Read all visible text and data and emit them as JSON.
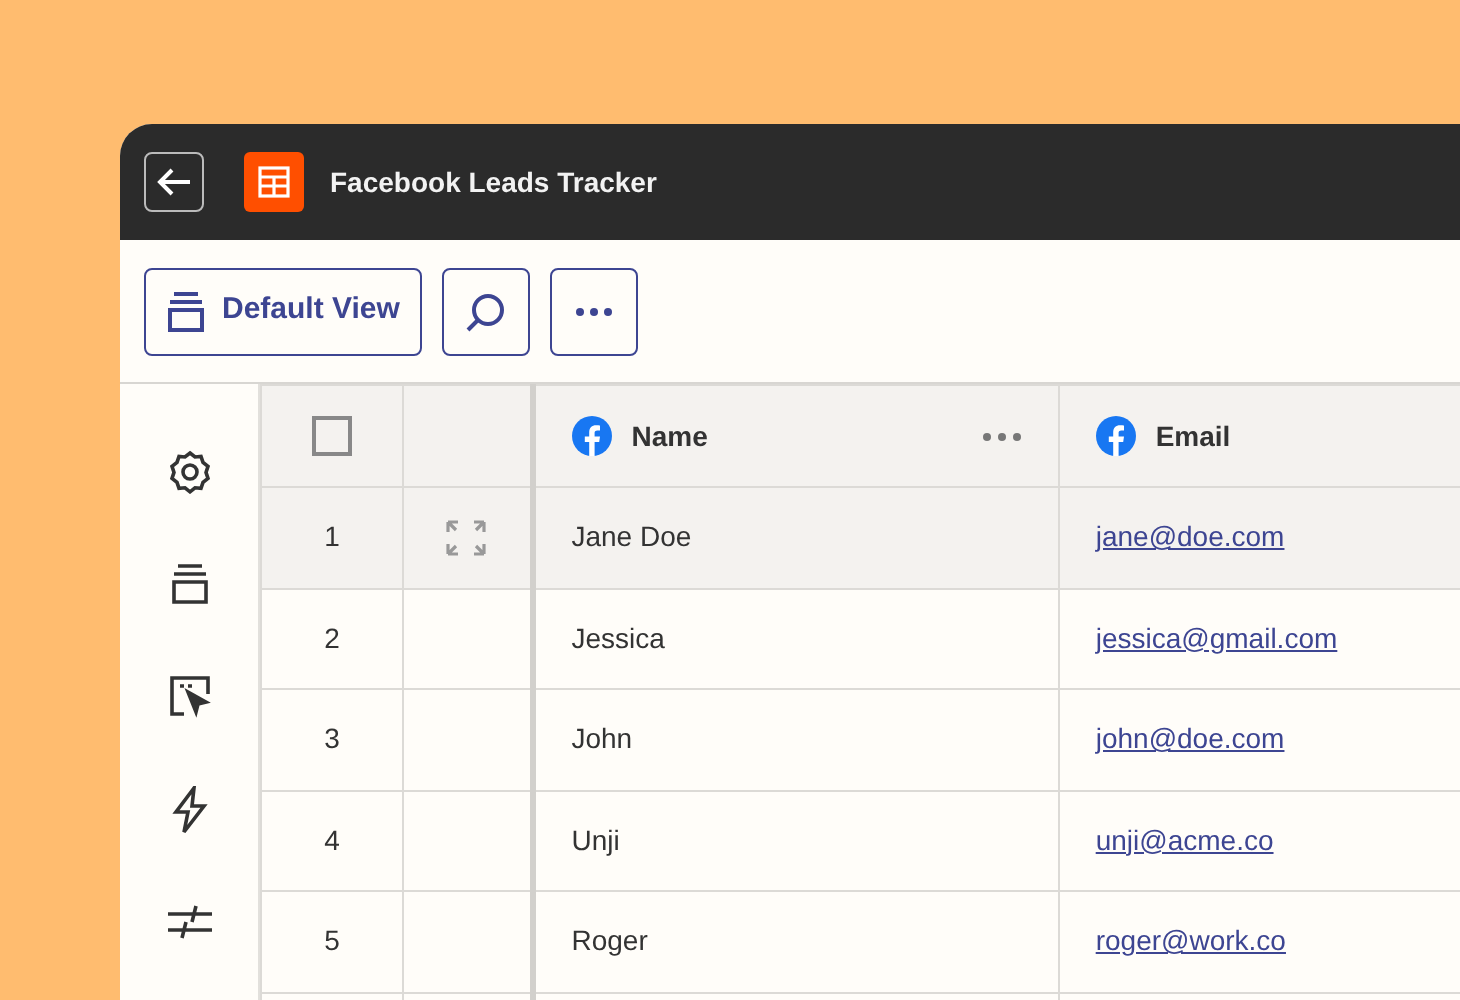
{
  "window": {
    "title": "Facebook Leads Tracker"
  },
  "toolbar": {
    "view_button": "Default View"
  },
  "table": {
    "select_all_checked": false,
    "columns": [
      {
        "label": "Name"
      },
      {
        "label": "Email"
      }
    ],
    "rows": [
      {
        "number": "1",
        "hovered": true,
        "name": "Jane Doe",
        "email": "jane@doe.com"
      },
      {
        "number": "2",
        "hovered": false,
        "name": "Jessica",
        "email": "jessica@gmail.com"
      },
      {
        "number": "3",
        "hovered": false,
        "name": "John",
        "email": "john@doe.com"
      },
      {
        "number": "4",
        "hovered": false,
        "name": "Unji",
        "email": "unji@acme.co"
      },
      {
        "number": "5",
        "hovered": false,
        "name": "Roger",
        "email": "roger@work.co"
      }
    ]
  }
}
